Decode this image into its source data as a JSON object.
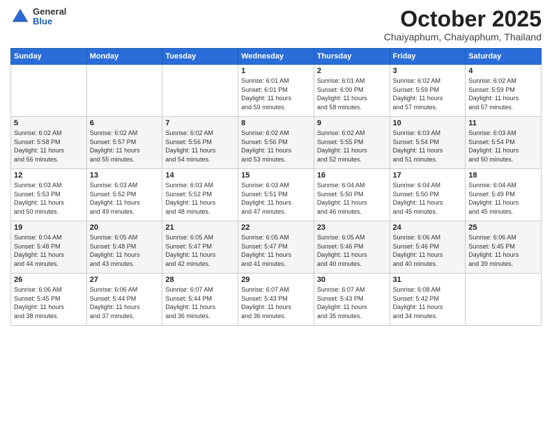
{
  "header": {
    "logo": {
      "general": "General",
      "blue": "Blue"
    },
    "month": "October 2025",
    "location": "Chaiyaphum, Chaiyaphum, Thailand"
  },
  "weekdays": [
    "Sunday",
    "Monday",
    "Tuesday",
    "Wednesday",
    "Thursday",
    "Friday",
    "Saturday"
  ],
  "weeks": [
    [
      {
        "day": "",
        "info": ""
      },
      {
        "day": "",
        "info": ""
      },
      {
        "day": "",
        "info": ""
      },
      {
        "day": "1",
        "info": "Sunrise: 6:01 AM\nSunset: 6:01 PM\nDaylight: 11 hours\nand 59 minutes."
      },
      {
        "day": "2",
        "info": "Sunrise: 6:01 AM\nSunset: 6:00 PM\nDaylight: 11 hours\nand 58 minutes."
      },
      {
        "day": "3",
        "info": "Sunrise: 6:02 AM\nSunset: 5:59 PM\nDaylight: 11 hours\nand 57 minutes."
      },
      {
        "day": "4",
        "info": "Sunrise: 6:02 AM\nSunset: 5:59 PM\nDaylight: 11 hours\nand 57 minutes."
      }
    ],
    [
      {
        "day": "5",
        "info": "Sunrise: 6:02 AM\nSunset: 5:58 PM\nDaylight: 11 hours\nand 56 minutes."
      },
      {
        "day": "6",
        "info": "Sunrise: 6:02 AM\nSunset: 5:57 PM\nDaylight: 11 hours\nand 55 minutes."
      },
      {
        "day": "7",
        "info": "Sunrise: 6:02 AM\nSunset: 5:56 PM\nDaylight: 11 hours\nand 54 minutes."
      },
      {
        "day": "8",
        "info": "Sunrise: 6:02 AM\nSunset: 5:56 PM\nDaylight: 11 hours\nand 53 minutes."
      },
      {
        "day": "9",
        "info": "Sunrise: 6:02 AM\nSunset: 5:55 PM\nDaylight: 11 hours\nand 52 minutes."
      },
      {
        "day": "10",
        "info": "Sunrise: 6:03 AM\nSunset: 5:54 PM\nDaylight: 11 hours\nand 51 minutes."
      },
      {
        "day": "11",
        "info": "Sunrise: 6:03 AM\nSunset: 5:54 PM\nDaylight: 11 hours\nand 50 minutes."
      }
    ],
    [
      {
        "day": "12",
        "info": "Sunrise: 6:03 AM\nSunset: 5:53 PM\nDaylight: 11 hours\nand 50 minutes."
      },
      {
        "day": "13",
        "info": "Sunrise: 6:03 AM\nSunset: 5:52 PM\nDaylight: 11 hours\nand 49 minutes."
      },
      {
        "day": "14",
        "info": "Sunrise: 6:03 AM\nSunset: 5:52 PM\nDaylight: 11 hours\nand 48 minutes."
      },
      {
        "day": "15",
        "info": "Sunrise: 6:03 AM\nSunset: 5:51 PM\nDaylight: 11 hours\nand 47 minutes."
      },
      {
        "day": "16",
        "info": "Sunrise: 6:04 AM\nSunset: 5:50 PM\nDaylight: 11 hours\nand 46 minutes."
      },
      {
        "day": "17",
        "info": "Sunrise: 6:04 AM\nSunset: 5:50 PM\nDaylight: 11 hours\nand 45 minutes."
      },
      {
        "day": "18",
        "info": "Sunrise: 6:04 AM\nSunset: 5:49 PM\nDaylight: 11 hours\nand 45 minutes."
      }
    ],
    [
      {
        "day": "19",
        "info": "Sunrise: 6:04 AM\nSunset: 5:48 PM\nDaylight: 11 hours\nand 44 minutes."
      },
      {
        "day": "20",
        "info": "Sunrise: 6:05 AM\nSunset: 5:48 PM\nDaylight: 11 hours\nand 43 minutes."
      },
      {
        "day": "21",
        "info": "Sunrise: 6:05 AM\nSunset: 5:47 PM\nDaylight: 11 hours\nand 42 minutes."
      },
      {
        "day": "22",
        "info": "Sunrise: 6:05 AM\nSunset: 5:47 PM\nDaylight: 11 hours\nand 41 minutes."
      },
      {
        "day": "23",
        "info": "Sunrise: 6:05 AM\nSunset: 5:46 PM\nDaylight: 11 hours\nand 40 minutes."
      },
      {
        "day": "24",
        "info": "Sunrise: 6:06 AM\nSunset: 5:46 PM\nDaylight: 11 hours\nand 40 minutes."
      },
      {
        "day": "25",
        "info": "Sunrise: 6:06 AM\nSunset: 5:45 PM\nDaylight: 11 hours\nand 39 minutes."
      }
    ],
    [
      {
        "day": "26",
        "info": "Sunrise: 6:06 AM\nSunset: 5:45 PM\nDaylight: 11 hours\nand 38 minutes."
      },
      {
        "day": "27",
        "info": "Sunrise: 6:06 AM\nSunset: 5:44 PM\nDaylight: 11 hours\nand 37 minutes."
      },
      {
        "day": "28",
        "info": "Sunrise: 6:07 AM\nSunset: 5:44 PM\nDaylight: 11 hours\nand 36 minutes."
      },
      {
        "day": "29",
        "info": "Sunrise: 6:07 AM\nSunset: 5:43 PM\nDaylight: 11 hours\nand 36 minutes."
      },
      {
        "day": "30",
        "info": "Sunrise: 6:07 AM\nSunset: 5:43 PM\nDaylight: 11 hours\nand 35 minutes."
      },
      {
        "day": "31",
        "info": "Sunrise: 6:08 AM\nSunset: 5:42 PM\nDaylight: 11 hours\nand 34 minutes."
      },
      {
        "day": "",
        "info": ""
      }
    ]
  ]
}
